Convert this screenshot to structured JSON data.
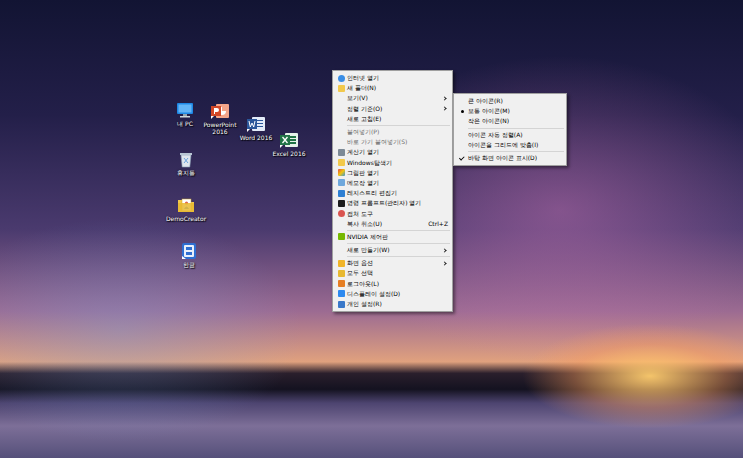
{
  "desktop_icons": [
    {
      "label": "내 PC",
      "kind": "pc"
    },
    {
      "label": "PowerPoint 2016",
      "kind": "powerpoint"
    },
    {
      "label": "Word 2016",
      "kind": "word"
    },
    {
      "label": "Excel 2016",
      "kind": "excel"
    },
    {
      "label": "휴지통",
      "kind": "trash"
    },
    {
      "label": "DemoCreator",
      "kind": "app"
    },
    {
      "label": "한글",
      "kind": "hangul"
    }
  ],
  "context_menu": {
    "items": [
      {
        "kind": "item",
        "label": "인터넷 열기",
        "disabled": false,
        "has_submenu": false
      },
      {
        "kind": "item",
        "label": "새 폴더(N)",
        "disabled": false,
        "has_submenu": false
      },
      {
        "kind": "item",
        "label": "보기(V)",
        "disabled": false,
        "has_submenu": true
      },
      {
        "kind": "item",
        "label": "정렬 기준(O)",
        "disabled": false,
        "has_submenu": true
      },
      {
        "kind": "item",
        "label": "새로 고침(E)",
        "disabled": false,
        "has_submenu": false
      },
      {
        "kind": "separator"
      },
      {
        "kind": "item",
        "label": "붙여넣기(P)",
        "disabled": true,
        "has_submenu": false
      },
      {
        "kind": "item",
        "label": "바로 가기 붙여넣기(S)",
        "disabled": true,
        "has_submenu": false
      },
      {
        "kind": "item",
        "label": "계산기 열기",
        "disabled": false,
        "has_submenu": false
      },
      {
        "kind": "item",
        "label": "Windows탐색기",
        "disabled": false,
        "has_submenu": false
      },
      {
        "kind": "item",
        "label": "그림판 열기",
        "disabled": false,
        "has_submenu": false
      },
      {
        "kind": "item",
        "label": "메모장 열기",
        "disabled": false,
        "has_submenu": false
      },
      {
        "kind": "item",
        "label": "레지스트리 편집기",
        "disabled": false,
        "has_submenu": false
      },
      {
        "kind": "item",
        "label": "명령 프롬프트(관리자) 열기",
        "disabled": false,
        "has_submenu": false
      },
      {
        "kind": "item",
        "label": "캡처 도구",
        "disabled": false,
        "has_submenu": false
      },
      {
        "kind": "item",
        "label": "복사 취소(U)",
        "shortcut": "Ctrl+Z",
        "disabled": false,
        "has_submenu": false
      },
      {
        "kind": "separator"
      },
      {
        "kind": "item",
        "label": "NVIDIA 제어판",
        "disabled": false,
        "has_submenu": false
      },
      {
        "kind": "separator"
      },
      {
        "kind": "item",
        "label": "새로 만들기(W)",
        "disabled": false,
        "has_submenu": true
      },
      {
        "kind": "separator"
      },
      {
        "kind": "item",
        "label": "화면 옵션",
        "disabled": false,
        "has_submenu": true
      },
      {
        "kind": "item",
        "label": "모두 선택",
        "disabled": false,
        "has_submenu": false
      },
      {
        "kind": "item",
        "label": "로그아웃(L)",
        "disabled": false,
        "has_submenu": false
      },
      {
        "kind": "item",
        "label": "디스플레이 설정(D)",
        "disabled": false,
        "has_submenu": false
      },
      {
        "kind": "item",
        "label": "개인 설정(R)",
        "disabled": false,
        "has_submenu": false
      }
    ]
  },
  "view_submenu": {
    "items": [
      {
        "kind": "radio",
        "label": "큰 아이콘(R)",
        "checked": false
      },
      {
        "kind": "radio",
        "label": "보통 아이콘(M)",
        "checked": true
      },
      {
        "kind": "radio",
        "label": "작은 아이콘(N)",
        "checked": false
      },
      {
        "kind": "separator"
      },
      {
        "kind": "check",
        "label": "아이콘 자동 정렬(A)",
        "checked": false
      },
      {
        "kind": "check",
        "label": "아이콘을 그리드에 맞춤(I)",
        "checked": false
      },
      {
        "kind": "separator"
      },
      {
        "kind": "check",
        "label": "바탕 화면 아이콘 표시(D)",
        "checked": true
      }
    ]
  }
}
